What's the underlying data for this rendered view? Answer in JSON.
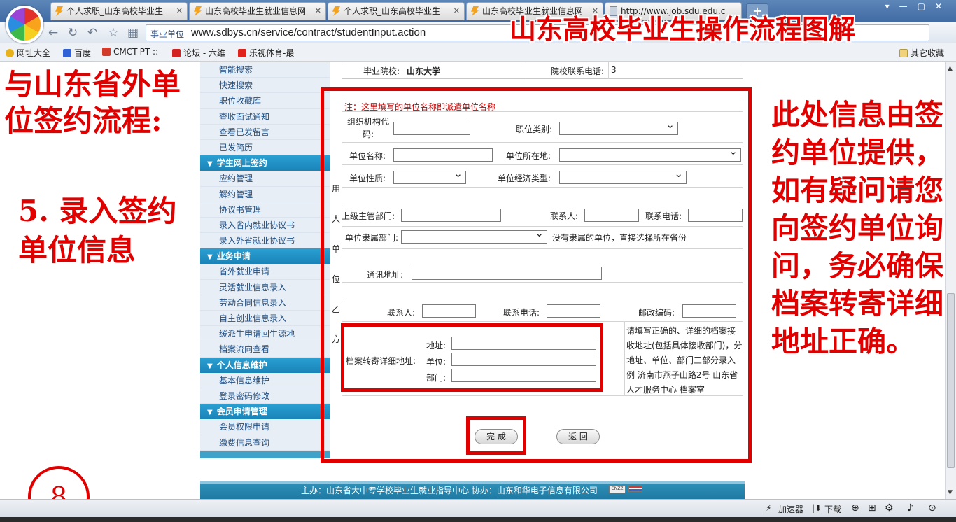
{
  "browser": {
    "tabs": [
      {
        "label": "个人求职_山东高校毕业生",
        "icon": "bolt"
      },
      {
        "label": "山东高校毕业生就业信息网",
        "icon": "bolt"
      },
      {
        "label": "个人求职_山东高校毕业生",
        "icon": "bolt"
      },
      {
        "label": "山东高校毕业生就业信息网",
        "icon": "bolt"
      },
      {
        "label": "http://www.job.sdu.edu.c",
        "icon": "page"
      }
    ],
    "new_tab": "+",
    "address_label": "事业单位",
    "url": "www.sdbys.cn/service/contract/studentInput.action",
    "bookmarks": [
      {
        "label": "网址大全",
        "color": "#e8b21a"
      },
      {
        "label": "百度",
        "color": "#2f62d6"
      },
      {
        "label": "CMCT-PT ::",
        "color": "#d43a2a"
      },
      {
        "label": "论坛 - 六维",
        "color": "#d42222"
      },
      {
        "label": "乐视体育-最",
        "color": "#e0231b"
      }
    ],
    "other_bookmarks": "其它收藏",
    "status": {
      "accelerator": "加速器",
      "download": "下载"
    }
  },
  "banner_title": "山东高校毕业生操作流程图解",
  "left_overlay": {
    "title": "与山东省外单位签约流程:",
    "step": "5. 录入签约单位信息",
    "step_number": "8"
  },
  "right_overlay": {
    "note": "此处信息由签约单位提供，如有疑问请您向签约单位询问，务必确保档案转寄详细地址正确。"
  },
  "sidebar": {
    "items_top": [
      "智能搜索",
      "快速搜索",
      "职位收藏库",
      "查收面试通知",
      "查看已发留言",
      "已发简历"
    ],
    "groups": [
      {
        "title": "学生网上签约",
        "items": [
          "应约管理",
          "解约管理",
          "协议书管理",
          "录入省内就业协议书",
          "录入外省就业协议书"
        ]
      },
      {
        "title": "业务申请",
        "items": [
          "省外就业申请",
          "灵活就业信息录入",
          "劳动合同信息录入",
          "自主创业信息录入",
          "缓派生申请回生源地",
          "档案流向查看"
        ]
      },
      {
        "title": "个人信息维护",
        "items": [
          "基本信息维护",
          "登录密码修改"
        ]
      },
      {
        "title": "会员申请管理",
        "items": [
          "会员权限申请",
          "缴费信息查询"
        ]
      }
    ]
  },
  "form": {
    "school_label": "毕业院校:",
    "school_value": "山东大学",
    "school_phone_label": "院校联系电话:",
    "school_phone_value": "3",
    "note": "注：这里填写的单位名称即派遣单位名称",
    "side_label": "用人单位乙方",
    "org_code_label": "组织机构代码:",
    "job_type_label": "职位类别:",
    "unit_name_label": "单位名称:",
    "unit_location_label": "单位所在地:",
    "unit_nature_label": "单位性质:",
    "unit_econ_label": "单位经济类型:",
    "superior_dept_label": "上级主管部门:",
    "contact_label": "联系人:",
    "contact_phone_label": "联系电话:",
    "affiliated_dept_label": "单位隶属部门:",
    "affiliated_hint": "没有隶属的单位，直接选择所在省份",
    "address_label": "通讯地址:",
    "contact2_label": "联系人:",
    "contact_phone2_label": "联系电话:",
    "postcode_label": "邮政编码:",
    "archive_label": "档案转寄详细地址:",
    "archive_addr_label": "地址:",
    "archive_unit_label": "单位:",
    "archive_dept_label": "部门:",
    "archive_hint": "请填写正确的、详细的档案接收地址(包括具体接收部门)，分地址、单位、部门三部分录入例 济南市燕子山路2号 山东省人才服务中心 档案室",
    "submit": "完 成",
    "back": "返 回"
  },
  "footer": {
    "text": "主办：山东省大中专学校毕业生就业指导中心 协办：山东和华电子信息有限公司",
    "badge": "CNZZ"
  },
  "colors": {
    "annotation_red": "#e00000",
    "sidebar_header": "#1f8fc4",
    "footer": "#2585ae"
  }
}
